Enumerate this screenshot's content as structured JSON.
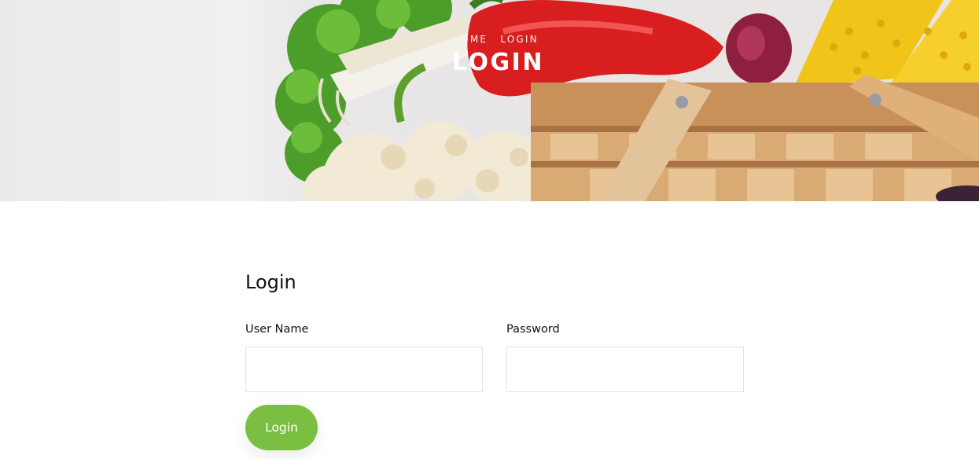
{
  "hero": {
    "breadcrumb": {
      "home": "HOME",
      "current": "LOGIN"
    },
    "title": "LOGIN"
  },
  "form": {
    "title": "Login",
    "username": {
      "label": "User Name",
      "value": "",
      "placeholder": ""
    },
    "password": {
      "label": "Password",
      "value": "",
      "placeholder": ""
    },
    "submit_label": "Login"
  },
  "theme": {
    "accent": "#7bbf42"
  }
}
